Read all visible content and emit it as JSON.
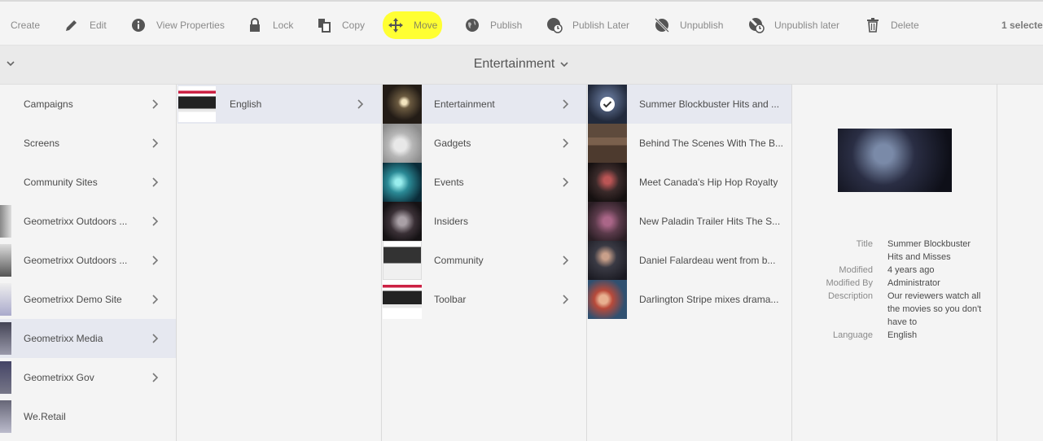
{
  "toolbar": {
    "create": "Create",
    "edit": "Edit",
    "view_properties": "View Properties",
    "lock": "Lock",
    "copy": "Copy",
    "move": "Move",
    "publish": "Publish",
    "publish_later": "Publish Later",
    "unpublish": "Unpublish",
    "unpublish_later": "Unpublish later",
    "delete": "Delete",
    "selected_count": "1 selecte",
    "highlight_color": "#ffff33"
  },
  "title": "Entertainment",
  "columns": {
    "sites": [
      {
        "label": "Campaigns"
      },
      {
        "label": "Screens"
      },
      {
        "label": "Community Sites"
      },
      {
        "label": "Geometrixx Outdoors ..."
      },
      {
        "label": "Geometrixx Outdoors ..."
      },
      {
        "label": "Geometrixx Demo Site"
      },
      {
        "label": "Geometrixx Media"
      },
      {
        "label": "Geometrixx Gov"
      },
      {
        "label": "We.Retail"
      }
    ],
    "languages": [
      {
        "label": "English"
      }
    ],
    "sections": [
      {
        "label": "Entertainment"
      },
      {
        "label": "Gadgets"
      },
      {
        "label": "Events"
      },
      {
        "label": "Insiders"
      },
      {
        "label": "Community"
      },
      {
        "label": "Toolbar"
      }
    ],
    "articles": [
      {
        "label": "Summer Blockbuster Hits and ..."
      },
      {
        "label": "Behind The Scenes With The B..."
      },
      {
        "label": "Meet Canada's Hip Hop Royalty"
      },
      {
        "label": "New Paladin Trailer Hits The S..."
      },
      {
        "label": "Daniel Falardeau went from b..."
      },
      {
        "label": "Darlington Stripe mixes drama..."
      }
    ]
  },
  "details": {
    "title_label": "Title",
    "title_value": "Summer Blockbuster Hits and Misses",
    "modified_label": "Modified",
    "modified_value": "4 years ago",
    "modified_by_label": "Modified By",
    "modified_by_value": "Administrator",
    "description_label": "Description",
    "description_value": "Our reviewers watch all the movies so you don't have to",
    "language_label": "Language",
    "language_value": "English"
  }
}
